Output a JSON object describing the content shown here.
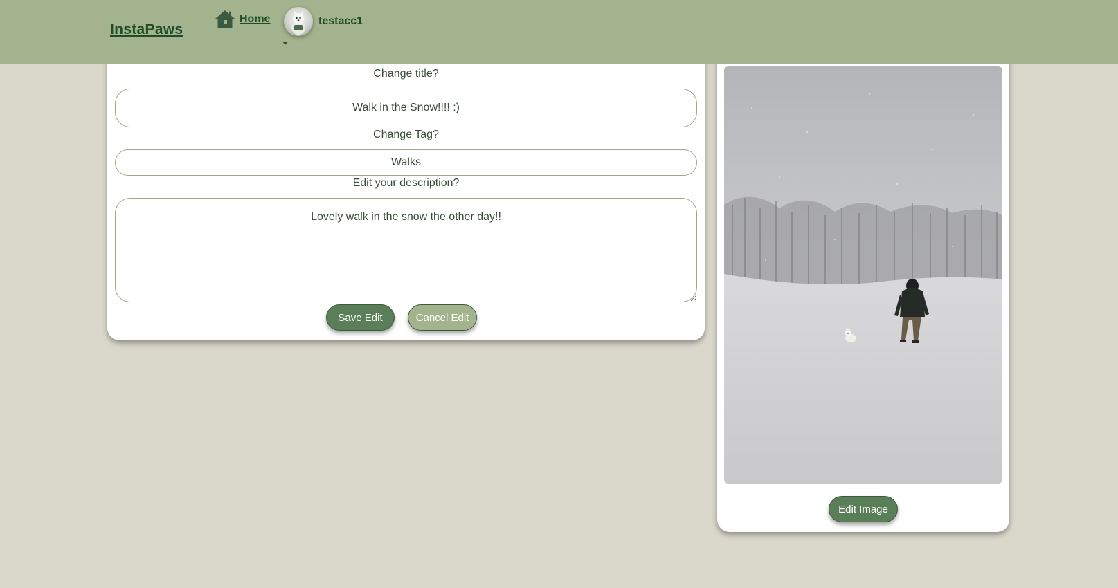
{
  "nav": {
    "brand": "InstaPaws",
    "home_label": "Home",
    "username": "testacc1"
  },
  "edit_form": {
    "title_label": "Change title?",
    "title_value": "Walk in the Snow!!!! :)",
    "tag_label": "Change Tag?",
    "tag_value": "Walks",
    "description_label": "Edit your description?",
    "description_value": "Lovely walk in the snow the other day!!",
    "save_label": "Save Edit",
    "cancel_label": "Cancel Edit"
  },
  "image_panel": {
    "edit_image_label": "Edit Image"
  },
  "colors": {
    "navbar": "#a3b38d",
    "background": "#dad8cb",
    "primary_button": "#5a7f58",
    "secondary_button": "#a3b38d",
    "brand_text": "#1f4d2c"
  },
  "icons": {
    "home": "home-icon",
    "dropdown": "caret-down-icon"
  }
}
